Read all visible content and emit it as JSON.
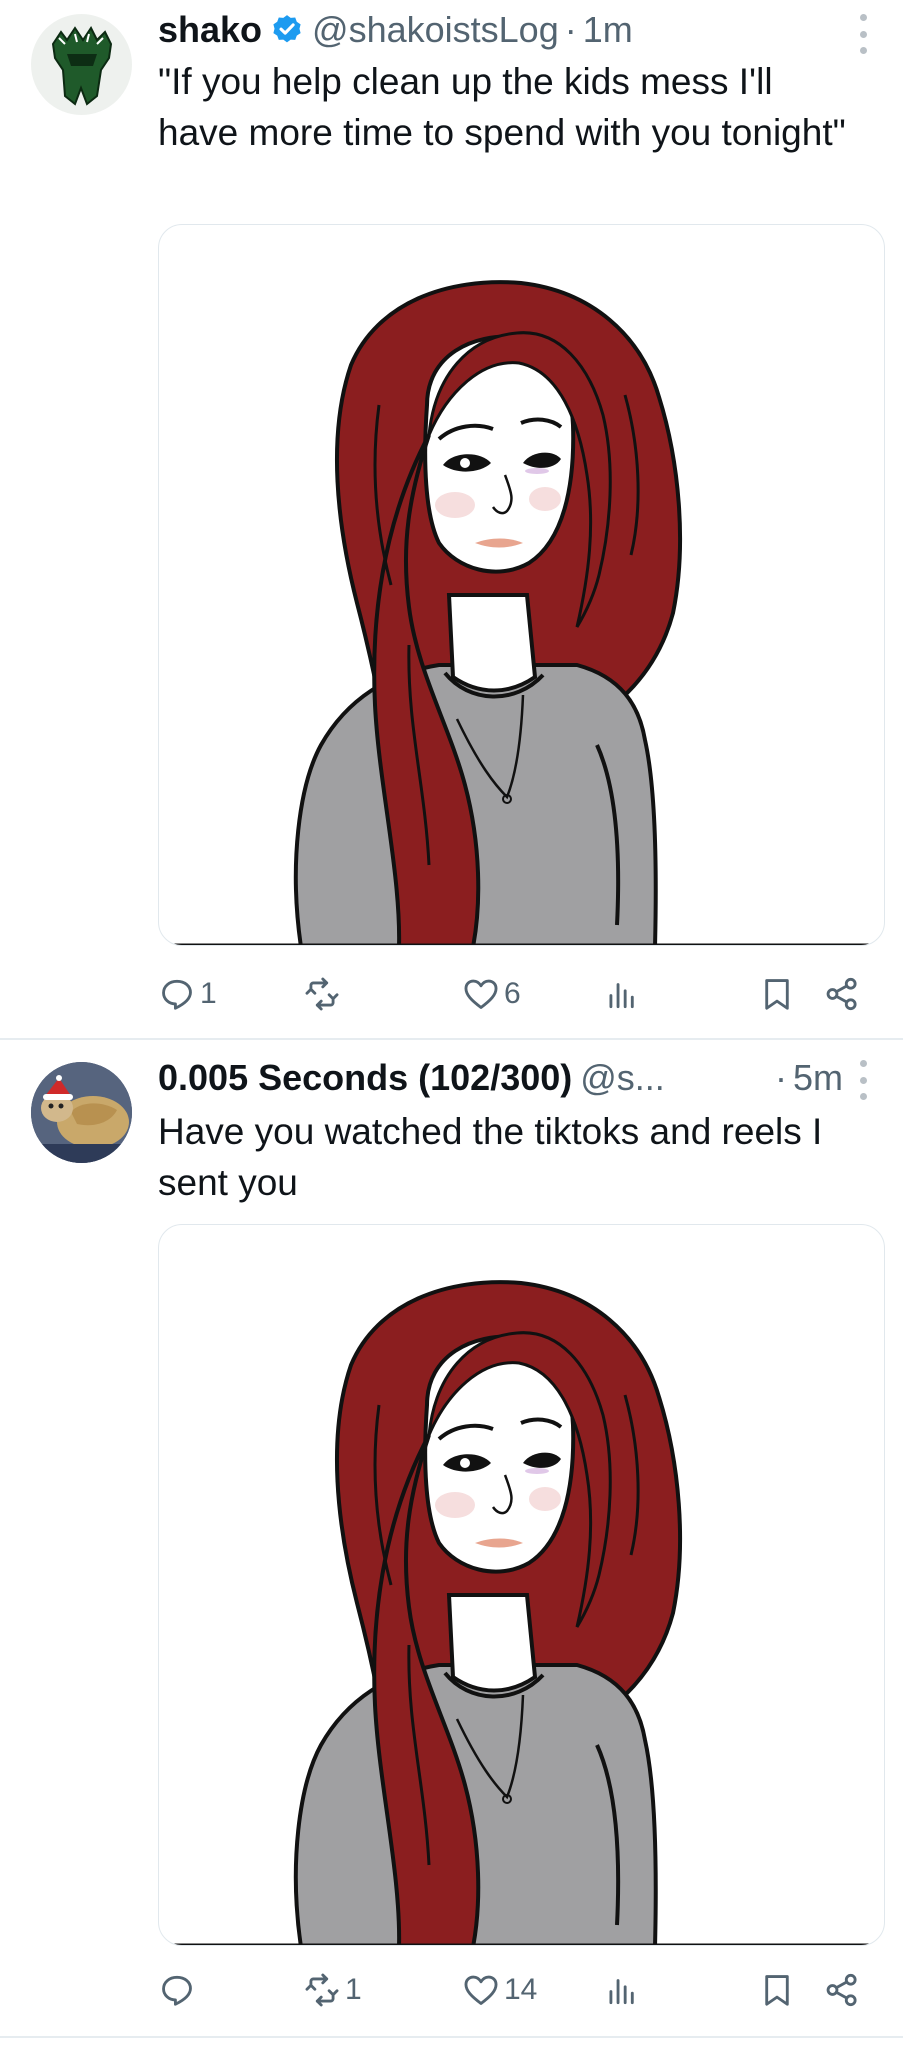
{
  "tweets": [
    {
      "author": "shako",
      "verified": true,
      "handle": "@shakoistsLog",
      "dot": "·",
      "time": "1m",
      "text": "\"If you help clean up the kids mess I'll have more time to spend with you tonight\"",
      "media": "illustration: red-haired woman in gray shirt",
      "stats": {
        "replies": "1",
        "reposts": "",
        "likes": "6"
      }
    },
    {
      "author": "0.005 Seconds (102/300)",
      "verified": false,
      "handle": "@s...",
      "dot": "·",
      "time": "5m",
      "text": "Have you watched the tiktoks and reels I sent you",
      "media": "illustration: red-haired woman in gray shirt",
      "stats": {
        "replies": "",
        "reposts": "1",
        "likes": "14"
      }
    }
  ],
  "colors": {
    "text": "#0f1419",
    "muted": "#536471",
    "verified": "#1d9bf0",
    "hair": "#8b1e1f",
    "shirt": "#a0a0a2"
  },
  "icons": [
    "reply-icon",
    "repost-icon",
    "like-icon",
    "views-icon",
    "bookmark-icon",
    "share-icon",
    "more-icon",
    "verified-icon"
  ]
}
